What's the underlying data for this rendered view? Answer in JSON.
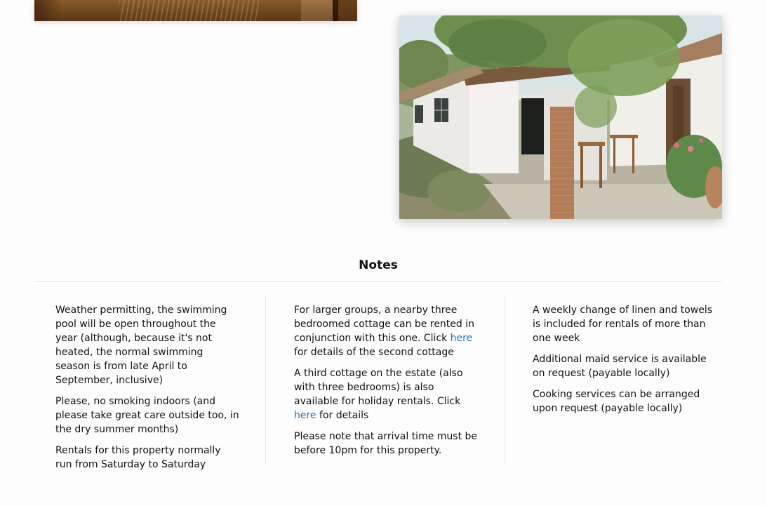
{
  "notes": {
    "title": "Notes",
    "col1": [
      "Weather permitting, the swimming pool will be open throughout the year (although, because it's not heated, the normal swimming season is from late April to September, inclusive)",
      "Please, no smoking indoors (and please take great care outside too, in the dry summer months)",
      "Rentals for this property normally run from Saturday to Saturday"
    ],
    "col2": {
      "p1_before": "For larger groups, a nearby three bedroomed cottage can be rented in conjunction with this one. Click ",
      "p1_link": "here",
      "p1_after": " for details of the second cottage",
      "p2_before": "A third cottage on the estate (also with three bedrooms) is also available for holiday rentals. Click ",
      "p2_link": "here",
      "p2_after": " for details",
      "p3": "Please note that arrival time must be before 10pm for this property."
    },
    "col3": [
      "A weekly change of linen and towels is included for rentals of more than one week",
      "Additional maid service is available on request (payable locally)",
      "Cooking services can be arranged upon request (payable locally)"
    ]
  },
  "colors": {
    "link": "#2a6fb3",
    "divider": "#e2e2e2",
    "background": "#fdfdfd"
  }
}
